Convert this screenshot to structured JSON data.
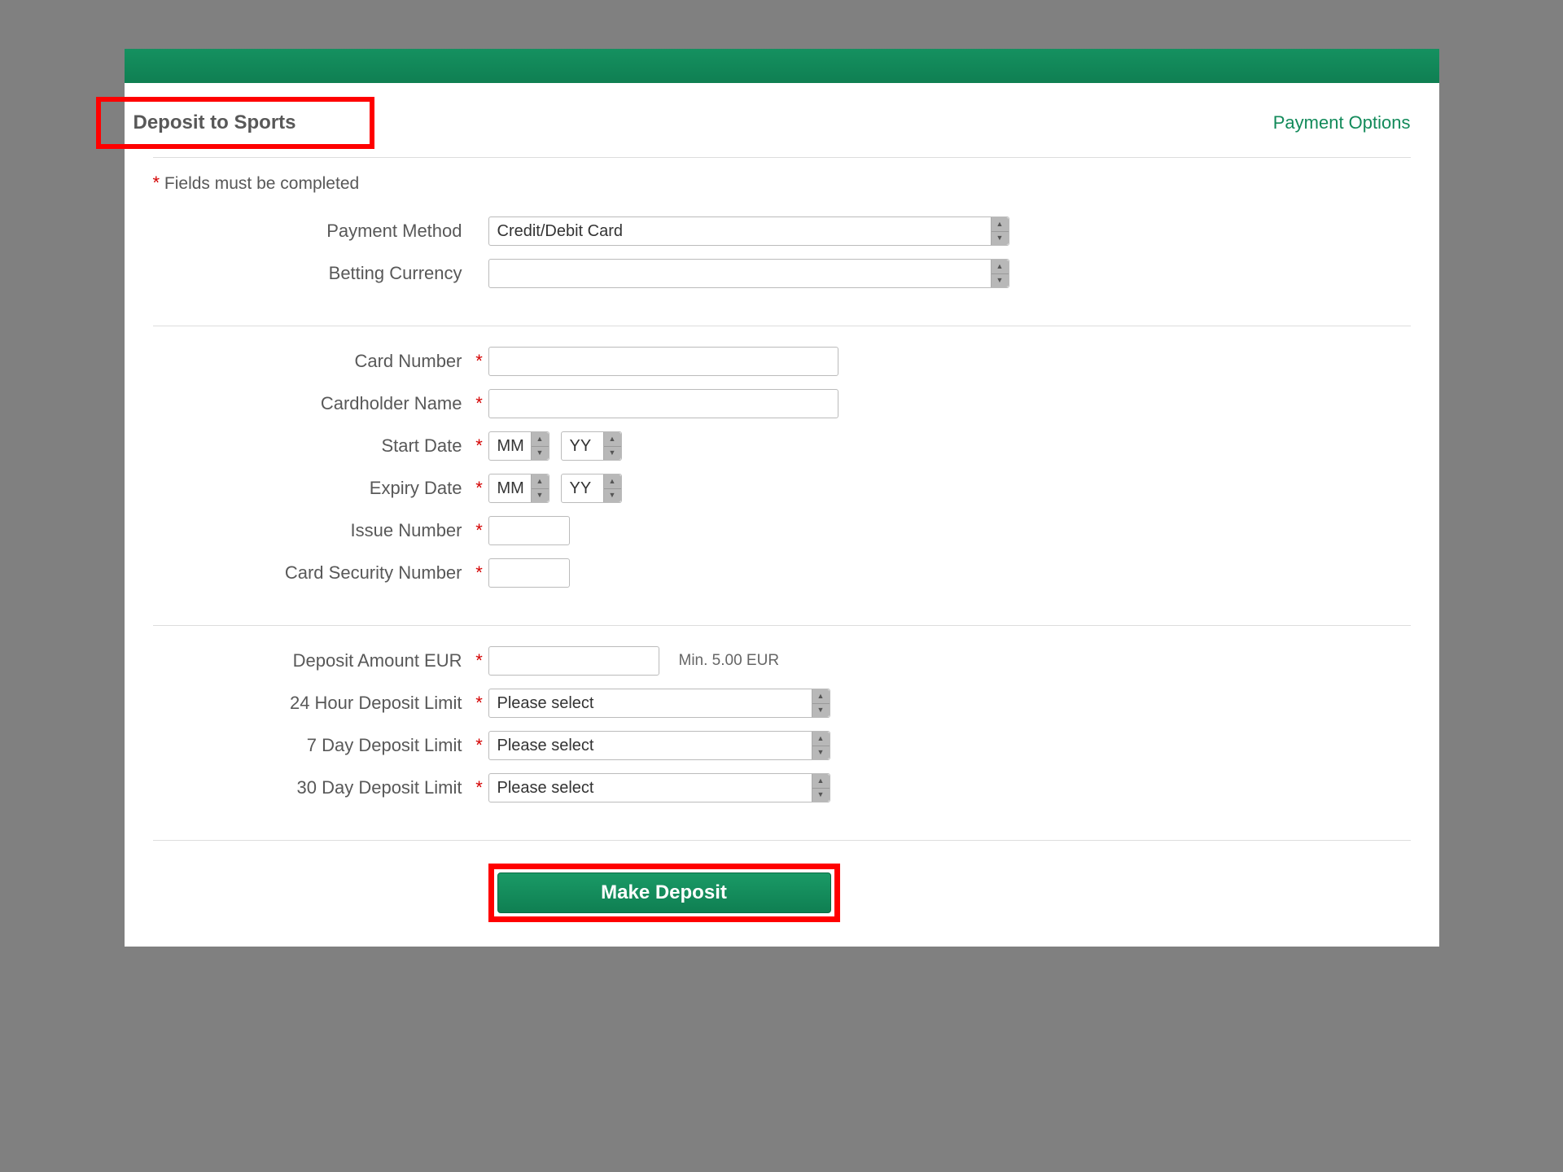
{
  "header": {
    "title": "Deposit to Sports",
    "payment_options_link": "Payment Options"
  },
  "required_note": "Fields must be completed",
  "section1": {
    "payment_method_label": "Payment Method",
    "payment_method_value": "Credit/Debit Card",
    "betting_currency_label": "Betting Currency",
    "betting_currency_value": ""
  },
  "section2": {
    "card_number_label": "Card Number",
    "cardholder_name_label": "Cardholder Name",
    "start_date_label": "Start Date",
    "expiry_date_label": "Expiry Date",
    "issue_number_label": "Issue Number",
    "csn_label": "Card Security Number",
    "mm_placeholder": "MM",
    "yy_placeholder": "YY"
  },
  "section3": {
    "deposit_amount_label": "Deposit Amount EUR",
    "deposit_min_hint": "Min. 5.00 EUR",
    "limit_24h_label": "24 Hour Deposit Limit",
    "limit_7d_label": "7 Day Deposit Limit",
    "limit_30d_label": "30 Day Deposit Limit",
    "please_select": "Please select"
  },
  "submit_label": "Make Deposit"
}
